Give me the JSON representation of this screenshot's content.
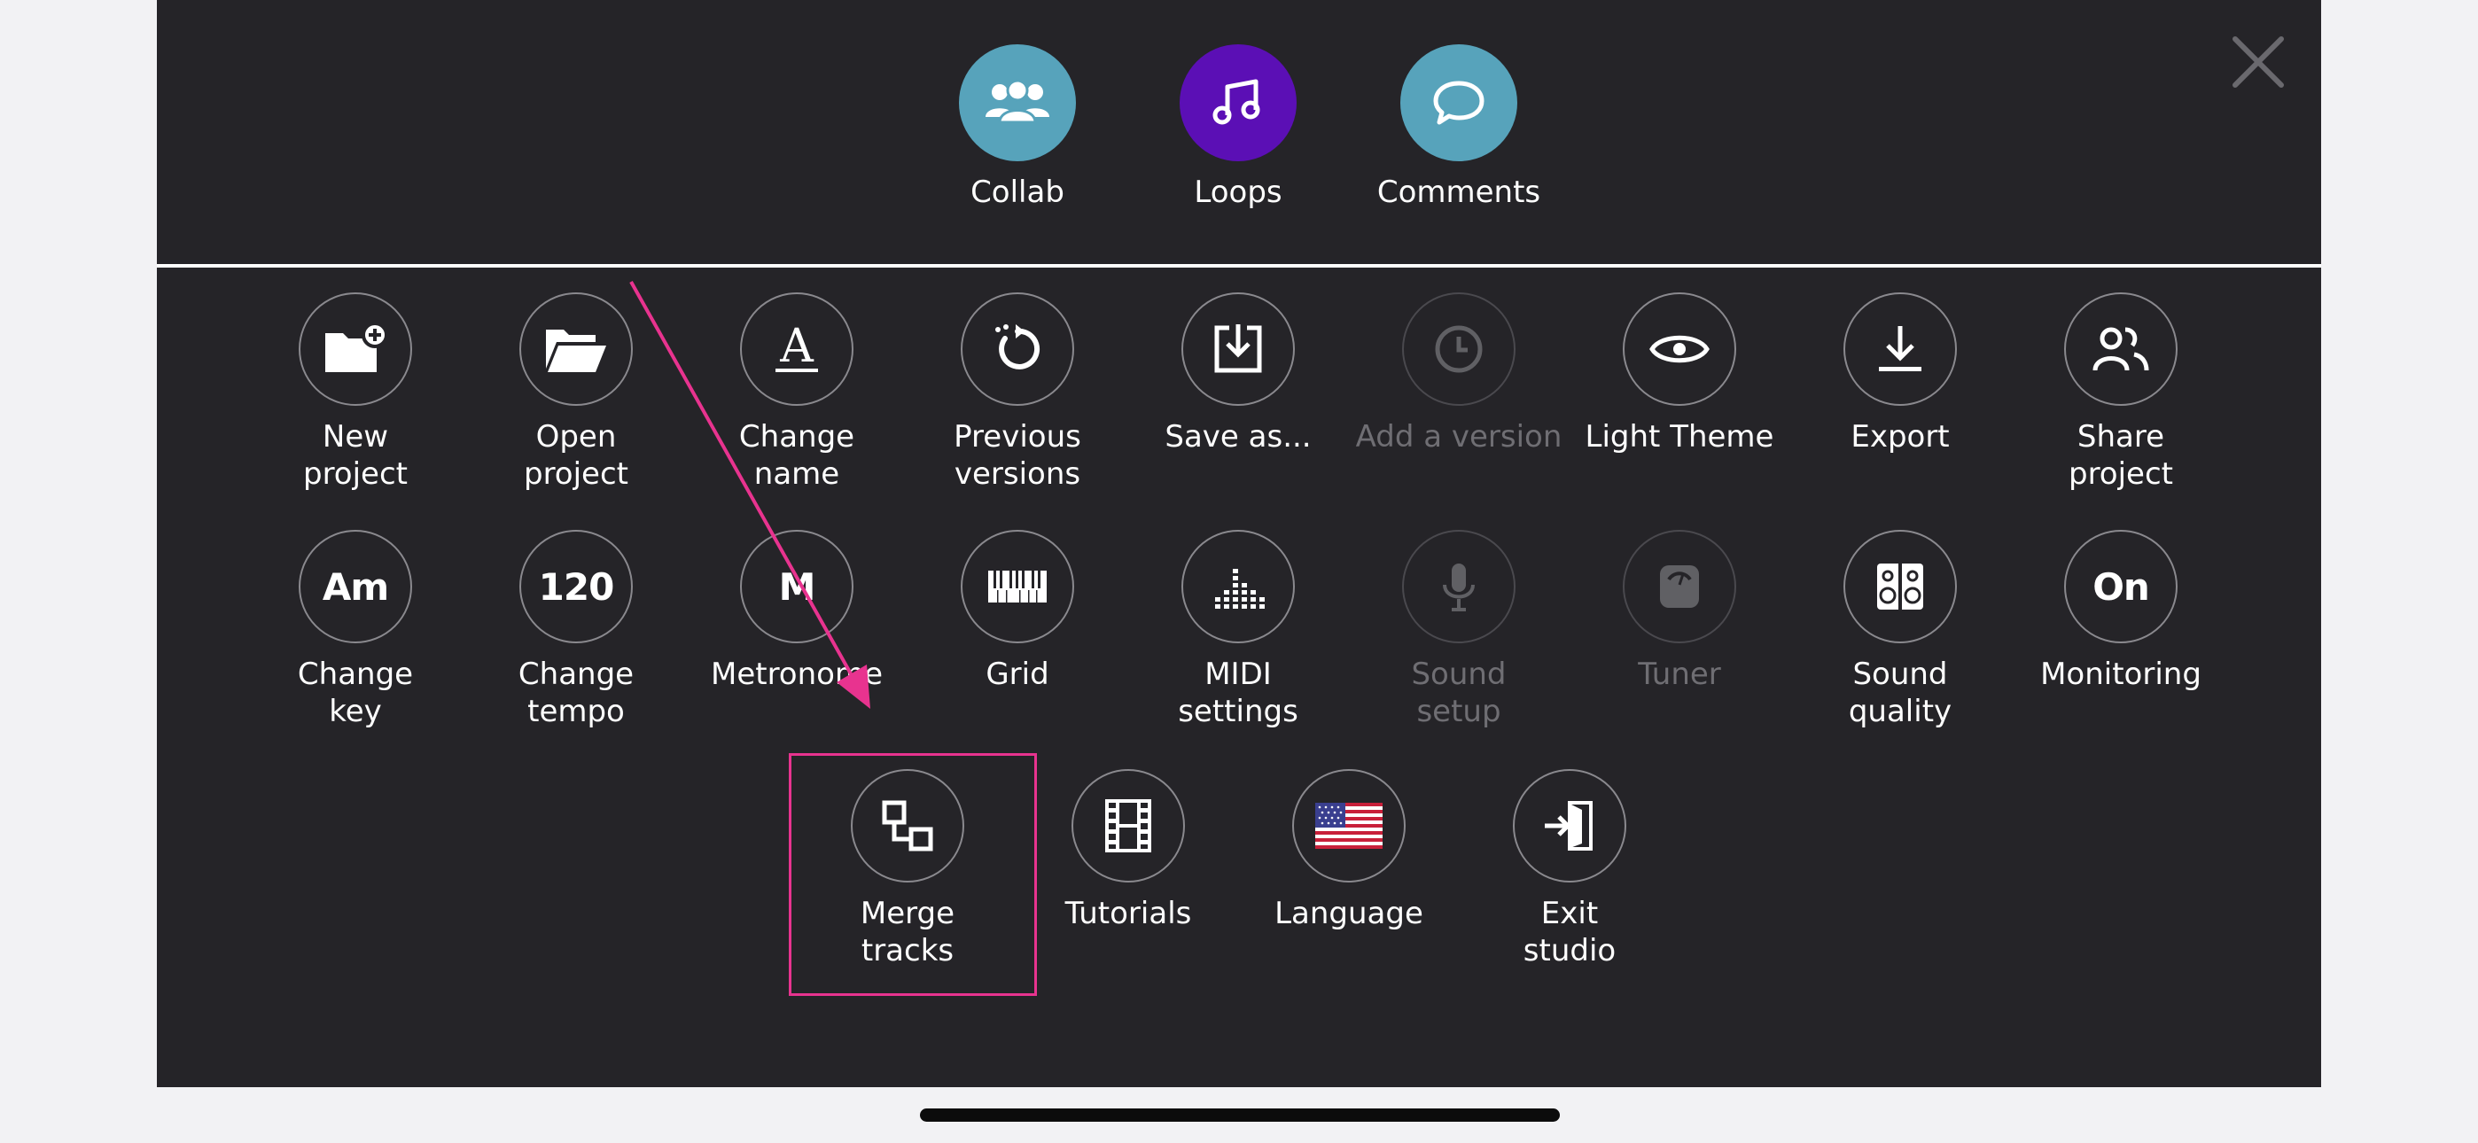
{
  "top_actions": [
    {
      "label": "Collab",
      "icon": "people-icon",
      "color": "#57a3bb"
    },
    {
      "label": "Loops",
      "icon": "music-note-icon",
      "color": "#5b0fb5"
    },
    {
      "label": "Comments",
      "icon": "speech-bubble-icon",
      "color": "#57a3bb"
    }
  ],
  "menu_row1": [
    {
      "label": "New\nproject",
      "icon": "new-folder-icon"
    },
    {
      "label": "Open\nproject",
      "icon": "open-folder-icon"
    },
    {
      "label": "Change\nname",
      "icon": "letter-a-icon"
    },
    {
      "label": "Previous\nversions",
      "icon": "history-icon"
    },
    {
      "label": "Save as...",
      "icon": "save-icon"
    },
    {
      "label": "Add a version",
      "icon": "clock-icon",
      "disabled": true
    },
    {
      "label": "Light Theme",
      "icon": "eye-icon"
    },
    {
      "label": "Export",
      "icon": "download-icon"
    },
    {
      "label": "Share\nproject",
      "icon": "share-people-icon"
    }
  ],
  "menu_row2": [
    {
      "label": "Change\nkey",
      "icon_text": "Am"
    },
    {
      "label": "Change\ntempo",
      "icon_text": "120"
    },
    {
      "label": "Metronome",
      "icon_text": "M"
    },
    {
      "label": "Grid",
      "icon": "piano-keys-icon"
    },
    {
      "label": "MIDI\nsettings",
      "icon": "equalizer-icon"
    },
    {
      "label": "Sound\nsetup",
      "icon": "microphone-icon",
      "disabled": true
    },
    {
      "label": "Tuner",
      "icon": "tuner-icon",
      "disabled": true
    },
    {
      "label": "Sound\nquality",
      "icon": "speaker-icon"
    },
    {
      "label": "Monitoring",
      "icon_text": "On"
    }
  ],
  "menu_row3": [
    {
      "label": "Merge\ntracks",
      "icon": "merge-icon",
      "highlighted": true
    },
    {
      "label": "Tutorials",
      "icon": "film-icon"
    },
    {
      "label": "Language",
      "icon": "us-flag-icon"
    },
    {
      "label": "Exit\nstudio",
      "icon": "exit-icon"
    }
  ],
  "annotation_color": "#e8338f"
}
